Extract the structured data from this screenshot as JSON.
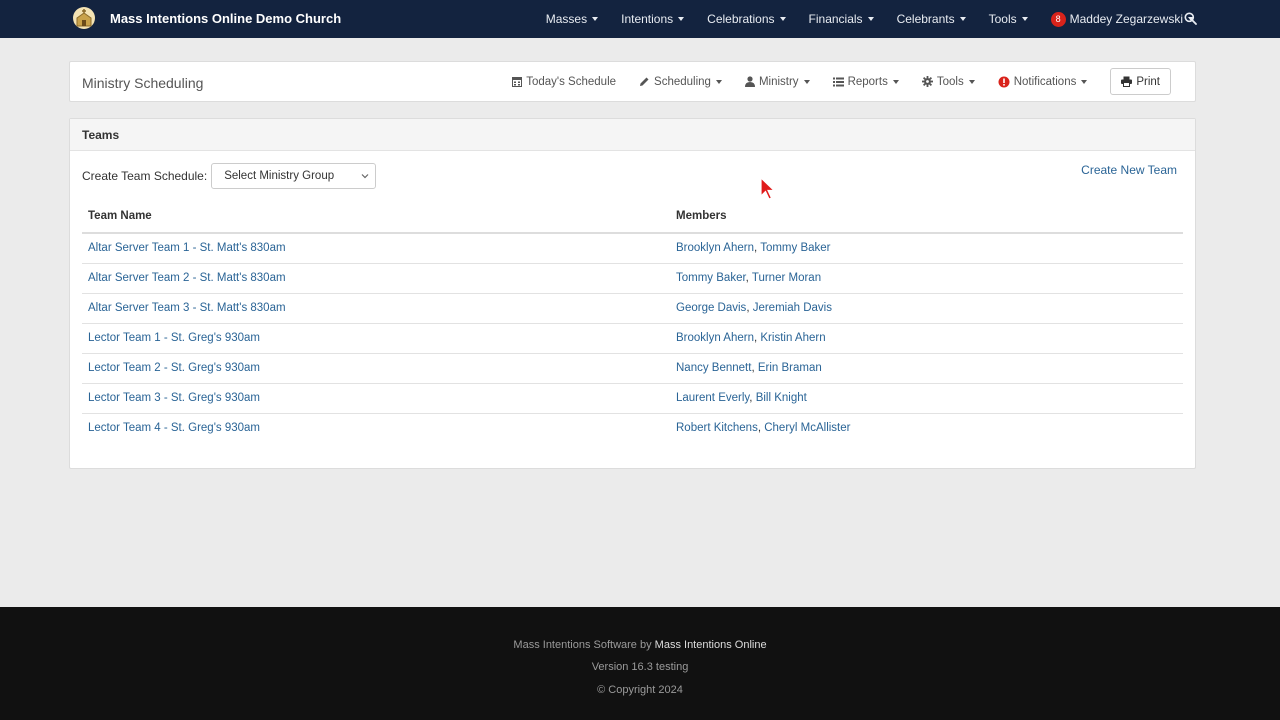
{
  "navbar": {
    "brand": "Mass Intentions Online Demo Church",
    "items": [
      {
        "label": "Masses"
      },
      {
        "label": "Intentions"
      },
      {
        "label": "Celebrations"
      },
      {
        "label": "Financials"
      },
      {
        "label": "Celebrants"
      },
      {
        "label": "Tools"
      }
    ],
    "user": {
      "badge": "8",
      "name": "Maddey Zegarzewski"
    }
  },
  "toolbar": {
    "title": "Ministry Scheduling",
    "todays_schedule": "Today's Schedule",
    "scheduling": "Scheduling",
    "ministry": "Ministry",
    "reports": "Reports",
    "tools": "Tools",
    "notifications": "Notifications",
    "print": "Print"
  },
  "teams": {
    "header": "Teams",
    "create_label": "Create Team Schedule:",
    "select_value": "Select Ministry Group",
    "create_new": "Create New Team",
    "columns": {
      "name": "Team Name",
      "members": "Members"
    },
    "rows": [
      {
        "name": "Altar Server Team 1 - St. Matt's 830am",
        "m1": "Brooklyn Ahern",
        "m2": "Tommy Baker"
      },
      {
        "name": "Altar Server Team 2 - St. Matt's 830am",
        "m1": "Tommy Baker",
        "m2": "Turner Moran"
      },
      {
        "name": "Altar Server Team 3 - St. Matt's 830am",
        "m1": "George Davis",
        "m2": "Jeremiah Davis"
      },
      {
        "name": "Lector Team 1 - St. Greg's 930am",
        "m1": "Brooklyn Ahern",
        "m2": "Kristin Ahern"
      },
      {
        "name": "Lector Team 2 - St. Greg's 930am",
        "m1": "Nancy Bennett",
        "m2": "Erin Braman"
      },
      {
        "name": "Lector Team 3 - St. Greg's 930am",
        "m1": "Laurent Everly",
        "m2": "Bill Knight"
      },
      {
        "name": "Lector Team 4 - St. Greg's 930am",
        "m1": "Robert Kitchens",
        "m2": "Cheryl McAllister"
      }
    ]
  },
  "footer": {
    "software_prefix": "Mass Intentions Software by",
    "software_brand": "Mass Intentions Online",
    "version": "Version 16.3 testing",
    "copyright": "© Copyright 2024"
  },
  "icons": {
    "logo": "church-logo-icon",
    "search": "search-icon",
    "calendar": "calendar-icon",
    "pencil": "pencil-icon",
    "user": "user-icon",
    "list": "list-icon",
    "gear": "gear-icon",
    "alert": "exclamation-circle-icon",
    "print": "print-icon",
    "cursor": "mouse-pointer-icon"
  },
  "colors": {
    "navbar": "#13233f",
    "link": "#2a6496",
    "badge": "#d9231b",
    "footer": "#111111"
  }
}
